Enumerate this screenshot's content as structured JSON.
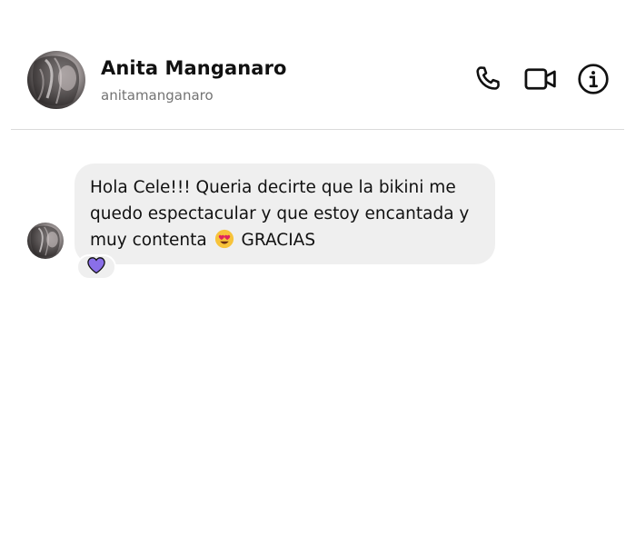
{
  "contact": {
    "name": "Anita Manganaro",
    "username": "anitamanganaro"
  },
  "header_icons": {
    "call": "phone-icon",
    "video": "video-camera-icon",
    "info": "info-icon"
  },
  "messages": [
    {
      "text_before_emoji": "Hola Cele!!! Queria decirte que la bikini me quedo espectacular y que estoy encantada y muy contenta",
      "emoji": "😍",
      "emoji_icon": "heart-eyes-emoji",
      "text_after_emoji": "GRACIAS",
      "reaction": "💜",
      "reaction_icon": "purple-heart-icon"
    }
  ],
  "colors": {
    "bubble": "#efefef",
    "reaction_heart": "#8a6fe8",
    "divider": "#dbdbdb",
    "secondary_text": "#737373"
  }
}
